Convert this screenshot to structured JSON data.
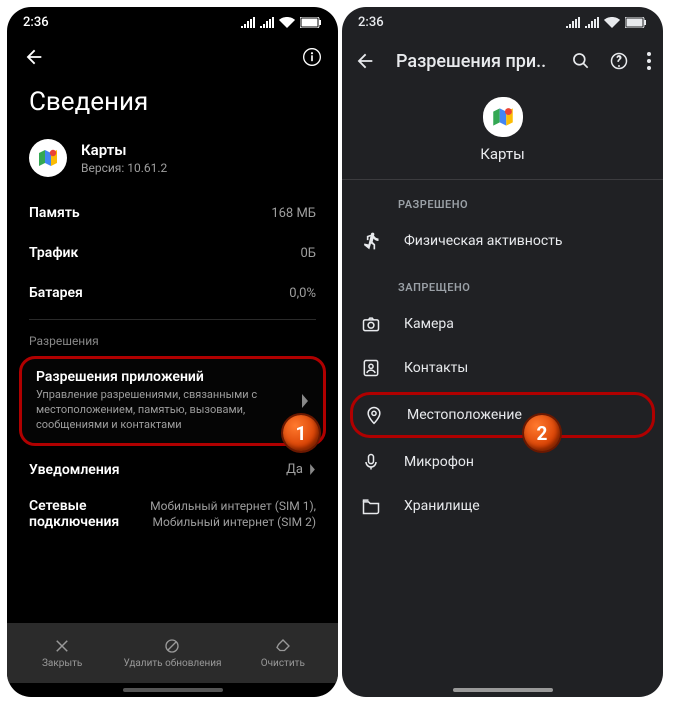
{
  "status": {
    "time": "2:36"
  },
  "left": {
    "title": "Сведения",
    "app_name": "Карты",
    "app_version": "Версия: 10.61.2",
    "rows": {
      "memory": {
        "k": "Память",
        "v": "168 МБ"
      },
      "traffic": {
        "k": "Трафик",
        "v": "0Б"
      },
      "battery": {
        "k": "Батарея",
        "v": "0,0%"
      }
    },
    "section_perm": "Разрешения",
    "perm_card": {
      "title": "Разрешения приложений",
      "sub": "Управление разрешениями, связанными с местоположением, памятью, вызовами, сообщениями и контактами"
    },
    "notif": {
      "k": "Уведомления",
      "v": "Да"
    },
    "net": {
      "k": "Сетевые подключения",
      "v": "Мобильный интернет (SIM 1), Мобильный интернет (SIM 2)"
    },
    "bb": {
      "close": "Закрыть",
      "uninstall": "Удалить обновления",
      "clear": "Очистить"
    }
  },
  "right": {
    "title": "Разрешения при..",
    "app_name": "Карты",
    "allowed": "РАЗРЕШЕНО",
    "denied": "ЗАПРЕЩЕНО",
    "items": {
      "activity": "Физическая активность",
      "camera": "Камера",
      "contacts": "Контакты",
      "location": "Местоположение",
      "mic": "Микрофон",
      "storage": "Хранилище"
    }
  },
  "badges": {
    "1": "1",
    "2": "2"
  }
}
